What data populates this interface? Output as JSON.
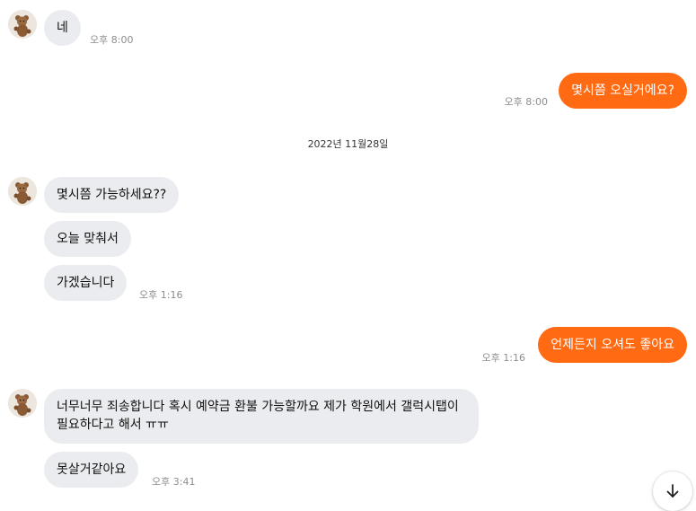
{
  "colors": {
    "outgoing_bubble": "#ff6a13",
    "incoming_bubble": "#ebecef",
    "timestamp": "#8d8d8d"
  },
  "avatar_icon": "teddy-bear-icon",
  "messages": {
    "m1": {
      "text": "네",
      "time": "오후 8:00"
    },
    "m2": {
      "text": "몇시쯤 오실거에요?",
      "time": "오후 8:00"
    },
    "date_separator": "2022년 11월28일",
    "m3": {
      "text": "몇시쯤 가능하세요??"
    },
    "m4": {
      "text": "오늘 맞춰서"
    },
    "m5": {
      "text": "가겠습니다",
      "time": "오후 1:16"
    },
    "m6": {
      "text": "언제든지 오셔도 좋아요",
      "time": "오후 1:16"
    },
    "m7": {
      "text": "너무너무 죄송합니다 혹시 예약금 환불 가능할까요 제가 학원에서 갤럭시탭이 필요하다고 해서 ㅠㅠ"
    },
    "m8": {
      "text": "못살거같아요",
      "time": "오후 3:41"
    }
  },
  "scroll_button_icon": "arrow-down-icon"
}
